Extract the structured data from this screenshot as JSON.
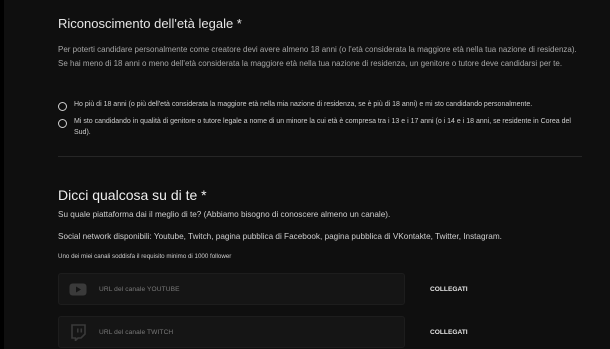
{
  "age_section": {
    "title": "Riconoscimento dell'età legale *",
    "description": "Per poterti candidare personalmente come creatore devi avere almeno 18 anni (o l'età considerata la maggiore età nella tua nazione di residenza). Se hai meno di 18 anni o meno dell'età considerata la maggiore età nella tua nazione di residenza, un genitore o tutore deve candidarsi per te.",
    "options": [
      {
        "label": "Ho più di 18 anni (o più dell'età considerata la maggiore età nella mia nazione di residenza, se è più di 18 anni) e mi sto candidando personalmente."
      },
      {
        "label": "Mi sto candidando in qualità di genitore o tutore legale a nome di un minore la cui età è compresa tra i 13 e i 17 anni (o i 14 e i 18 anni, se residente in Corea del Sud)."
      }
    ]
  },
  "about_section": {
    "title": "Dicci qualcosa su di te *",
    "question": "Su quale piattaforma dai il meglio di te? (Abbiamo bisogno di conoscere almeno un canale).",
    "social_networks": "Social network disponibili: Youtube, Twitch, pagina pubblica di Facebook, pagina pubblica di VKontakte, Twitter, Instagram.",
    "requirement": "Uno dei miei canali soddisfa il requisito minimo di 1000 follower"
  },
  "channels": [
    {
      "icon": "youtube-icon",
      "placeholder": "URL del canale YOUTUBE",
      "value": "",
      "button": "COLLEGATI"
    },
    {
      "icon": "twitch-icon",
      "placeholder": "URL del canale TWITCH",
      "value": "",
      "button": "COLLEGATI"
    }
  ],
  "colors": {
    "background": "#0f0f0f",
    "input_background": "#151515",
    "text": "#d4d4d4"
  }
}
